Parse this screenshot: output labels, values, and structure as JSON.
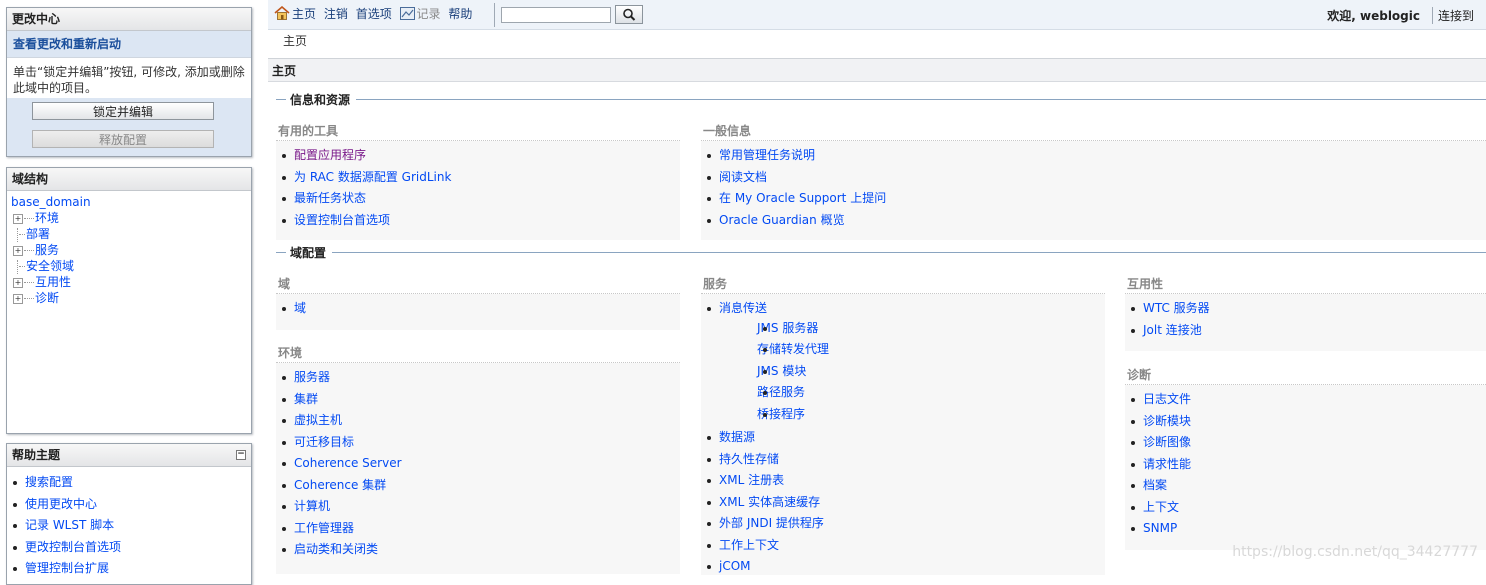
{
  "change_center": {
    "title": "更改中心",
    "subtitle": "查看更改和重新启动",
    "description": "单击“锁定并编辑”按钮, 可修改, 添加或删除此域中的项目。",
    "lock_button": "锁定并编辑",
    "release_button": "释放配置"
  },
  "domain_structure": {
    "title": "域结构",
    "root": "base_domain",
    "nodes": [
      {
        "label": "环境",
        "expandable": true
      },
      {
        "label": "部署",
        "expandable": false
      },
      {
        "label": "服务",
        "expandable": true
      },
      {
        "label": "安全领域",
        "expandable": false
      },
      {
        "label": "互用性",
        "expandable": true
      },
      {
        "label": "诊断",
        "expandable": true
      }
    ],
    "expand_glyph": "+"
  },
  "help_topics": {
    "title": "帮助主题",
    "collapse_glyph": "−",
    "items": [
      "搜索配置",
      "使用更改中心",
      "记录 WLST 脚本",
      "更改控制台首选项",
      "管理控制台扩展"
    ]
  },
  "topbar": {
    "home": "主页",
    "logout": "注销",
    "preferences": "首选项",
    "record": "记录",
    "help": "帮助",
    "search_value": "",
    "search_icon": "magnifier-icon",
    "welcome": "欢迎, weblogic",
    "connect": "连接到"
  },
  "breadcrumb": "主页",
  "page_title": "主页",
  "sections": {
    "info": "信息和资源",
    "domain_config": "域配置"
  },
  "useful_tools": {
    "title": "有用的工具",
    "items": [
      "配置应用程序",
      "为 RAC 数据源配置 GridLink",
      "最新任务状态",
      "设置控制台首选项"
    ]
  },
  "general_info": {
    "title": "一般信息",
    "items": [
      "常用管理任务说明",
      "阅读文档",
      "在 My Oracle Support 上提问",
      "Oracle Guardian 概览"
    ]
  },
  "domain_box": {
    "title": "域",
    "items": [
      "域"
    ]
  },
  "environment_box": {
    "title": "环境",
    "items": [
      "服务器",
      "集群",
      "虚拟主机",
      "可迁移目标",
      "Coherence Server",
      "Coherence 集群",
      "计算机",
      "工作管理器",
      "启动类和关闭类"
    ]
  },
  "services_box": {
    "title": "服务",
    "messaging": "消息传送",
    "messaging_sub": [
      "JMS 服务器",
      "存储转发代理",
      "JMS 模块",
      "路径服务",
      "桥接程序"
    ],
    "items": [
      "数据源",
      "持久性存储",
      "XML 注册表",
      "XML 实体高速缓存",
      "外部 JNDI 提供程序",
      "工作上下文",
      "jCOM"
    ]
  },
  "interop_box": {
    "title": "互用性",
    "items": [
      "WTC 服务器",
      "Jolt 连接池"
    ]
  },
  "diagnostics_box": {
    "title": "诊断",
    "items": [
      "日志文件",
      "诊断模块",
      "诊断图像",
      "请求性能",
      "档案",
      "上下文",
      "SNMP"
    ]
  },
  "watermark": "https://blog.csdn.net/qq_34427777",
  "colors": {
    "link": "#034af3",
    "visited": "#7a1a8a",
    "panel_blue": "#dce6f3"
  }
}
